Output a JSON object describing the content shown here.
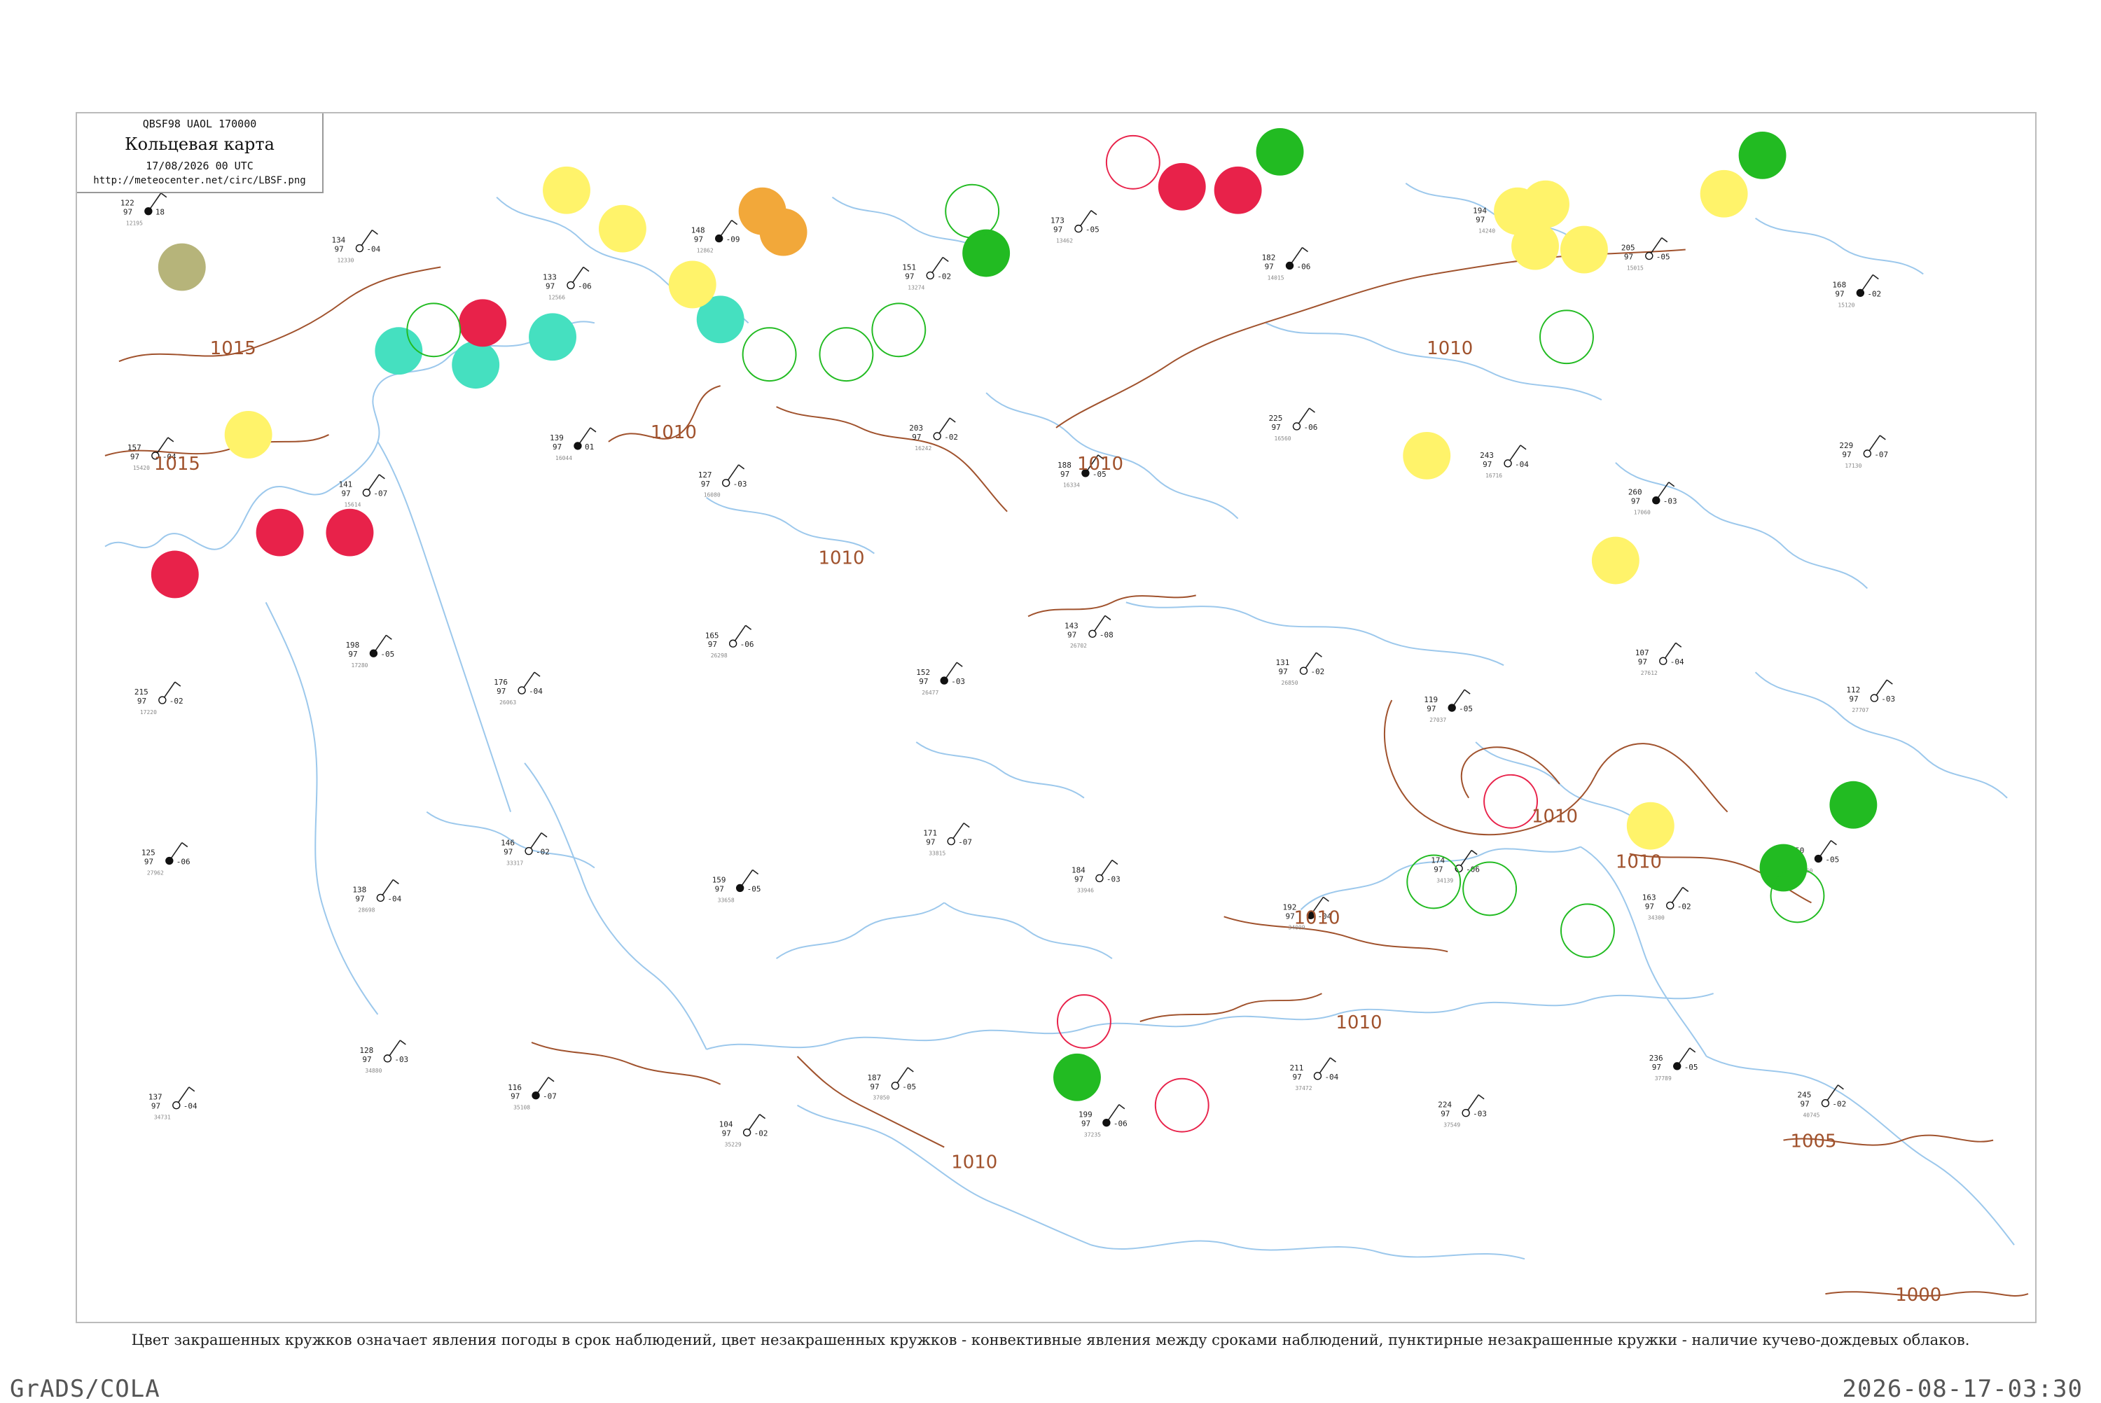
{
  "header": {
    "code_line": "QBSF98  UAOL  170000",
    "title": "Кольцевая карта",
    "date_line": "17/08/2026 00 UTC",
    "url": "http://meteocenter.net/circ/LBSF.png"
  },
  "caption": "Цвет закрашенных кружков означает явления погоды в срок наблюдений, цвет незакрашенных кружков - конвективные явления между сроками наблюдений, пунктирные незакрашенные кружки - наличие кучево-дождевых облаков.",
  "footer": {
    "software": "GrADS/COLA",
    "timestamp": "2026-08-17-03:30"
  },
  "isobar_labels": [
    "1015",
    "1015",
    "1010",
    "1010",
    "1010",
    "1010",
    "1010",
    "1010",
    "1010",
    "1010",
    "1010",
    "1005",
    "1000"
  ],
  "colors": {
    "coast": "#9cc8ec",
    "isobar": "#a0522d",
    "thunder": "#e8224a",
    "rain": "#22bb22",
    "shower": "#fff36a",
    "fog": "#f2a83a",
    "snow": "#45e0c0",
    "haze": "#b6b47a",
    "frame": "#bbbbbb"
  },
  "stations": [
    {
      "t": "122",
      "td": "97",
      "p": "18",
      "id": "12195"
    },
    {
      "t": "134",
      "td": "97",
      "p": "-04",
      "id": "12330"
    },
    {
      "t": "133",
      "td": "97",
      "p": "-06",
      "id": "12566"
    },
    {
      "t": "148",
      "td": "97",
      "p": "-09",
      "id": "12862"
    },
    {
      "t": "151",
      "td": "97",
      "p": "-02",
      "id": "13274"
    },
    {
      "t": "173",
      "td": "97",
      "p": "-05",
      "id": "13462"
    },
    {
      "t": "182",
      "td": "97",
      "p": "-06",
      "id": "14015"
    },
    {
      "t": "194",
      "td": "97",
      "p": "-03",
      "id": "14240"
    },
    {
      "t": "205",
      "td": "97",
      "p": "-05",
      "id": "15015"
    },
    {
      "t": "168",
      "td": "97",
      "p": "-02",
      "id": "15120"
    },
    {
      "t": "157",
      "td": "97",
      "p": "-04",
      "id": "15420"
    },
    {
      "t": "141",
      "td": "97",
      "p": "-07",
      "id": "15614"
    },
    {
      "t": "139",
      "td": "97",
      "p": "01",
      "id": "16044"
    },
    {
      "t": "127",
      "td": "97",
      "p": "-03",
      "id": "16080"
    },
    {
      "t": "203",
      "td": "97",
      "p": "-02",
      "id": "16242"
    },
    {
      "t": "188",
      "td": "97",
      "p": "-05",
      "id": "16334"
    },
    {
      "t": "225",
      "td": "97",
      "p": "-06",
      "id": "16560"
    },
    {
      "t": "243",
      "td": "97",
      "p": "-04",
      "id": "16716"
    },
    {
      "t": "260",
      "td": "97",
      "p": "-03",
      "id": "17060"
    },
    {
      "t": "229",
      "td": "97",
      "p": "-07",
      "id": "17130"
    },
    {
      "t": "215",
      "td": "97",
      "p": "-02",
      "id": "17220"
    },
    {
      "t": "198",
      "td": "97",
      "p": "-05",
      "id": "17280"
    },
    {
      "t": "176",
      "td": "97",
      "p": "-04",
      "id": "26063"
    },
    {
      "t": "165",
      "td": "97",
      "p": "-06",
      "id": "26298"
    },
    {
      "t": "152",
      "td": "97",
      "p": "-03",
      "id": "26477"
    },
    {
      "t": "143",
      "td": "97",
      "p": "-08",
      "id": "26702"
    },
    {
      "t": "131",
      "td": "97",
      "p": "-02",
      "id": "26850"
    },
    {
      "t": "119",
      "td": "97",
      "p": "-05",
      "id": "27037"
    },
    {
      "t": "107",
      "td": "97",
      "p": "-04",
      "id": "27612"
    },
    {
      "t": "112",
      "td": "97",
      "p": "-03",
      "id": "27707"
    },
    {
      "t": "125",
      "td": "97",
      "p": "-06",
      "id": "27962"
    },
    {
      "t": "138",
      "td": "97",
      "p": "-04",
      "id": "28698"
    },
    {
      "t": "146",
      "td": "97",
      "p": "-02",
      "id": "33317"
    },
    {
      "t": "159",
      "td": "97",
      "p": "-05",
      "id": "33658"
    },
    {
      "t": "171",
      "td": "97",
      "p": "-07",
      "id": "33815"
    },
    {
      "t": "184",
      "td": "97",
      "p": "-03",
      "id": "33946"
    },
    {
      "t": "192",
      "td": "97",
      "p": "-04",
      "id": "34009"
    },
    {
      "t": "174",
      "td": "97",
      "p": "-06",
      "id": "34139"
    },
    {
      "t": "163",
      "td": "97",
      "p": "-02",
      "id": "34300"
    },
    {
      "t": "150",
      "td": "97",
      "p": "-05",
      "id": "34560"
    },
    {
      "t": "137",
      "td": "97",
      "p": "-04",
      "id": "34731"
    },
    {
      "t": "128",
      "td": "97",
      "p": "-03",
      "id": "34880"
    },
    {
      "t": "116",
      "td": "97",
      "p": "-07",
      "id": "35108"
    },
    {
      "t": "104",
      "td": "97",
      "p": "-02",
      "id": "35229"
    },
    {
      "t": "187",
      "td": "97",
      "p": "-05",
      "id": "37050"
    },
    {
      "t": "199",
      "td": "97",
      "p": "-06",
      "id": "37235"
    },
    {
      "t": "211",
      "td": "97",
      "p": "-04",
      "id": "37472"
    },
    {
      "t": "224",
      "td": "97",
      "p": "-03",
      "id": "37549"
    },
    {
      "t": "236",
      "td": "97",
      "p": "-05",
      "id": "37789"
    },
    {
      "t": "245",
      "td": "97",
      "p": "-02",
      "id": "40745"
    }
  ],
  "circles": [
    {
      "kind": "filled",
      "color": "haze"
    },
    {
      "kind": "filled",
      "color": "shower"
    },
    {
      "kind": "filled",
      "color": "fog"
    },
    {
      "kind": "filled",
      "color": "shower"
    },
    {
      "kind": "filled",
      "color": "fog"
    },
    {
      "kind": "filled",
      "color": "shower"
    },
    {
      "kind": "filled",
      "color": "snow"
    },
    {
      "kind": "filled",
      "color": "snow"
    },
    {
      "kind": "filled",
      "color": "snow"
    },
    {
      "kind": "filled",
      "color": "thunder"
    },
    {
      "kind": "filled",
      "color": "snow"
    },
    {
      "kind": "filled",
      "color": "thunder"
    },
    {
      "kind": "filled",
      "color": "thunder"
    },
    {
      "kind": "filled",
      "color": "thunder"
    },
    {
      "kind": "filled",
      "color": "shower"
    },
    {
      "kind": "filled",
      "color": "rain"
    },
    {
      "kind": "filled",
      "color": "thunder"
    },
    {
      "kind": "filled",
      "color": "thunder"
    },
    {
      "kind": "filled",
      "color": "rain"
    },
    {
      "kind": "filled",
      "color": "shower"
    },
    {
      "kind": "filled",
      "color": "shower"
    },
    {
      "kind": "filled",
      "color": "shower"
    },
    {
      "kind": "filled",
      "color": "shower"
    },
    {
      "kind": "filled",
      "color": "rain"
    },
    {
      "kind": "filled",
      "color": "shower"
    },
    {
      "kind": "filled",
      "color": "shower"
    },
    {
      "kind": "filled",
      "color": "shower"
    },
    {
      "kind": "filled",
      "color": "shower"
    },
    {
      "kind": "filled",
      "color": "rain"
    },
    {
      "kind": "filled",
      "color": "rain"
    },
    {
      "kind": "filled",
      "color": "rain"
    },
    {
      "kind": "ring",
      "color": "rain"
    },
    {
      "kind": "ring",
      "color": "rain"
    },
    {
      "kind": "ring",
      "color": "rain"
    },
    {
      "kind": "ring",
      "color": "rain"
    },
    {
      "kind": "ring",
      "color": "rain"
    },
    {
      "kind": "ring",
      "color": "rain"
    },
    {
      "kind": "ring",
      "color": "rain"
    },
    {
      "kind": "ring",
      "color": "rain"
    },
    {
      "kind": "ring",
      "color": "rain"
    },
    {
      "kind": "ring",
      "color": "rain"
    },
    {
      "kind": "ring",
      "color": "thunder"
    },
    {
      "kind": "ring",
      "color": "thunder"
    },
    {
      "kind": "ring",
      "color": "thunder"
    },
    {
      "kind": "ring",
      "color": "thunder"
    }
  ]
}
